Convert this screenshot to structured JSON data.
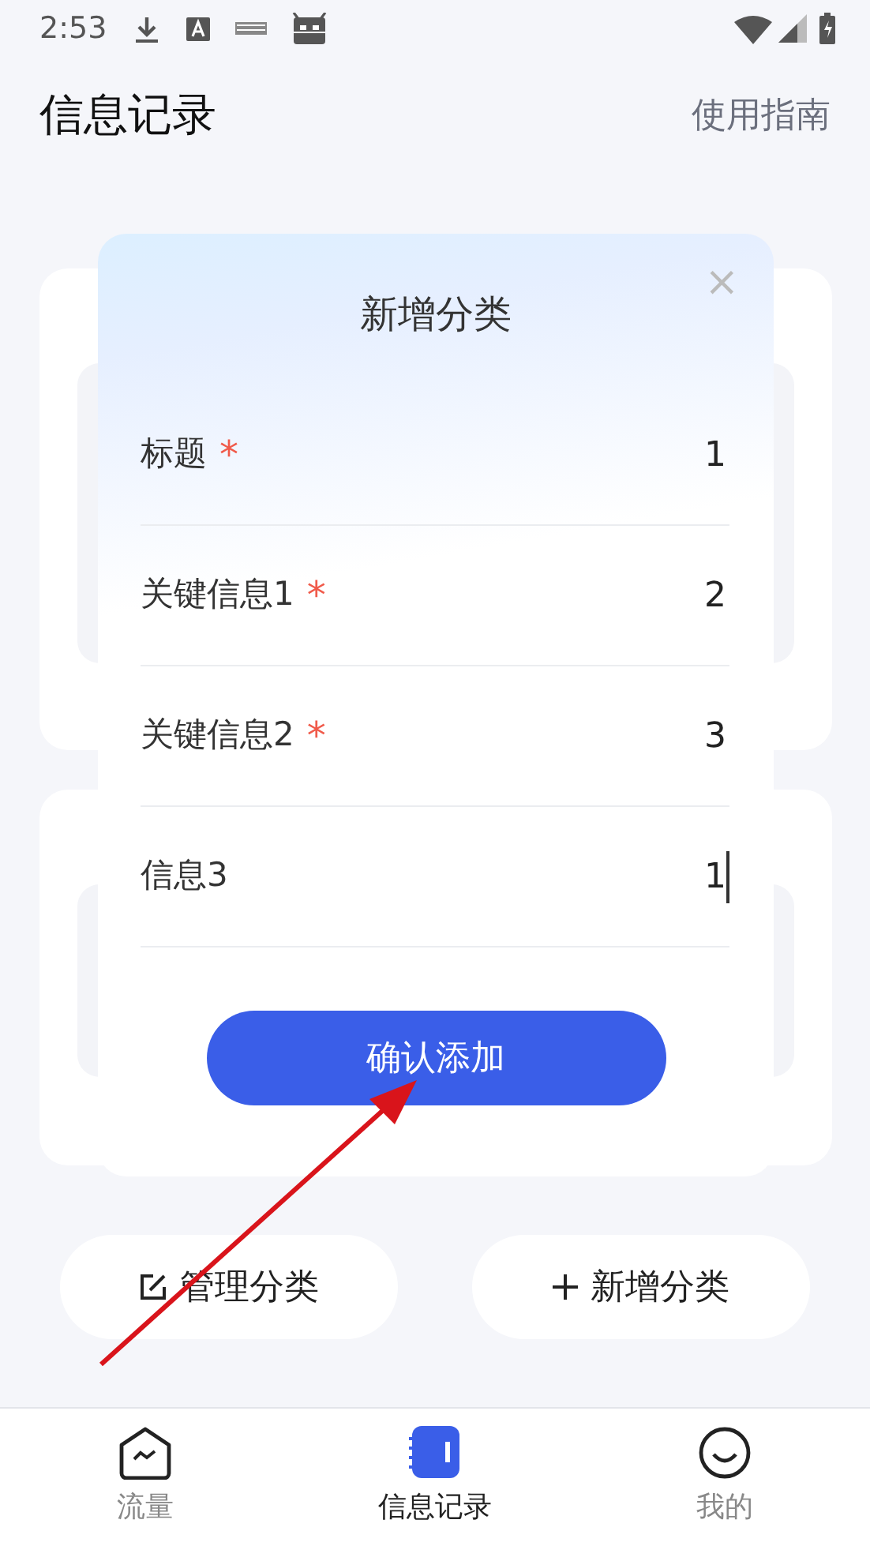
{
  "status_bar": {
    "time": "2:53"
  },
  "header": {
    "title": "信息记录",
    "guide_link": "使用指南"
  },
  "bottom_buttons": [
    {
      "kind": "edit",
      "label": "管理分类"
    },
    {
      "kind": "add",
      "label": "新增分类"
    }
  ],
  "dialog": {
    "title": "新增分类",
    "close": "×",
    "fields": [
      {
        "label": "标题",
        "required_mark": "*",
        "value": "1",
        "focused": false
      },
      {
        "label": "关键信息1",
        "required_mark": "*",
        "value": "2",
        "focused": false
      },
      {
        "label": "关键信息2",
        "required_mark": "*",
        "value": "3",
        "focused": false
      },
      {
        "label": "信息3",
        "value": "1",
        "focused": true
      }
    ],
    "confirm_button": "确认添加"
  },
  "nav": [
    {
      "kind": "chart",
      "label": "流量",
      "selected": false
    },
    {
      "kind": "notebook",
      "label": "信息记录",
      "selected": true
    },
    {
      "kind": "face",
      "label": "我的",
      "selected": false
    }
  ]
}
